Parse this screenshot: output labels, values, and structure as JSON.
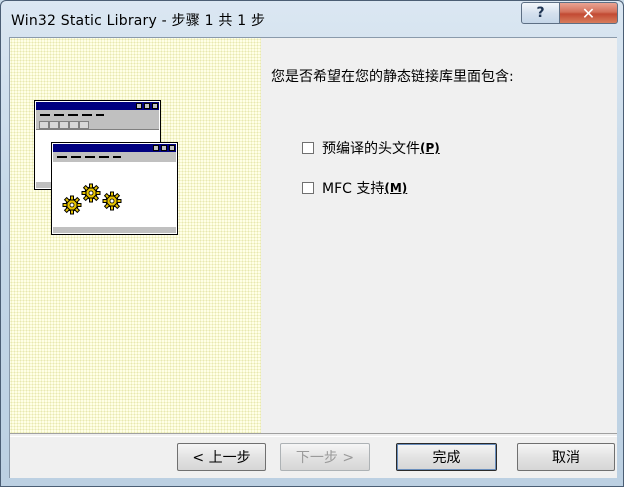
{
  "window": {
    "title": "Win32 Static Library - 步骤 1 共 1 步",
    "help_glyph": "?",
    "close_glyph": "✕"
  },
  "illustration": {
    "icon": "wizard-windows-gears-illustration"
  },
  "content": {
    "question": "您是否希望在您的静态链接库里面包含:",
    "options": [
      {
        "label": "预编译的头文件",
        "mnemonic": "(P)",
        "checked": false
      },
      {
        "label": "MFC 支持",
        "mnemonic": "(M)",
        "checked": false
      }
    ]
  },
  "buttons": {
    "back": "< 上一步",
    "next": "下一步 >",
    "finish": "完成",
    "cancel": "取消"
  },
  "colors": {
    "left_pane": "#ffffe6",
    "title_bar_blue": "#000080",
    "close_red": "#c24a33"
  }
}
